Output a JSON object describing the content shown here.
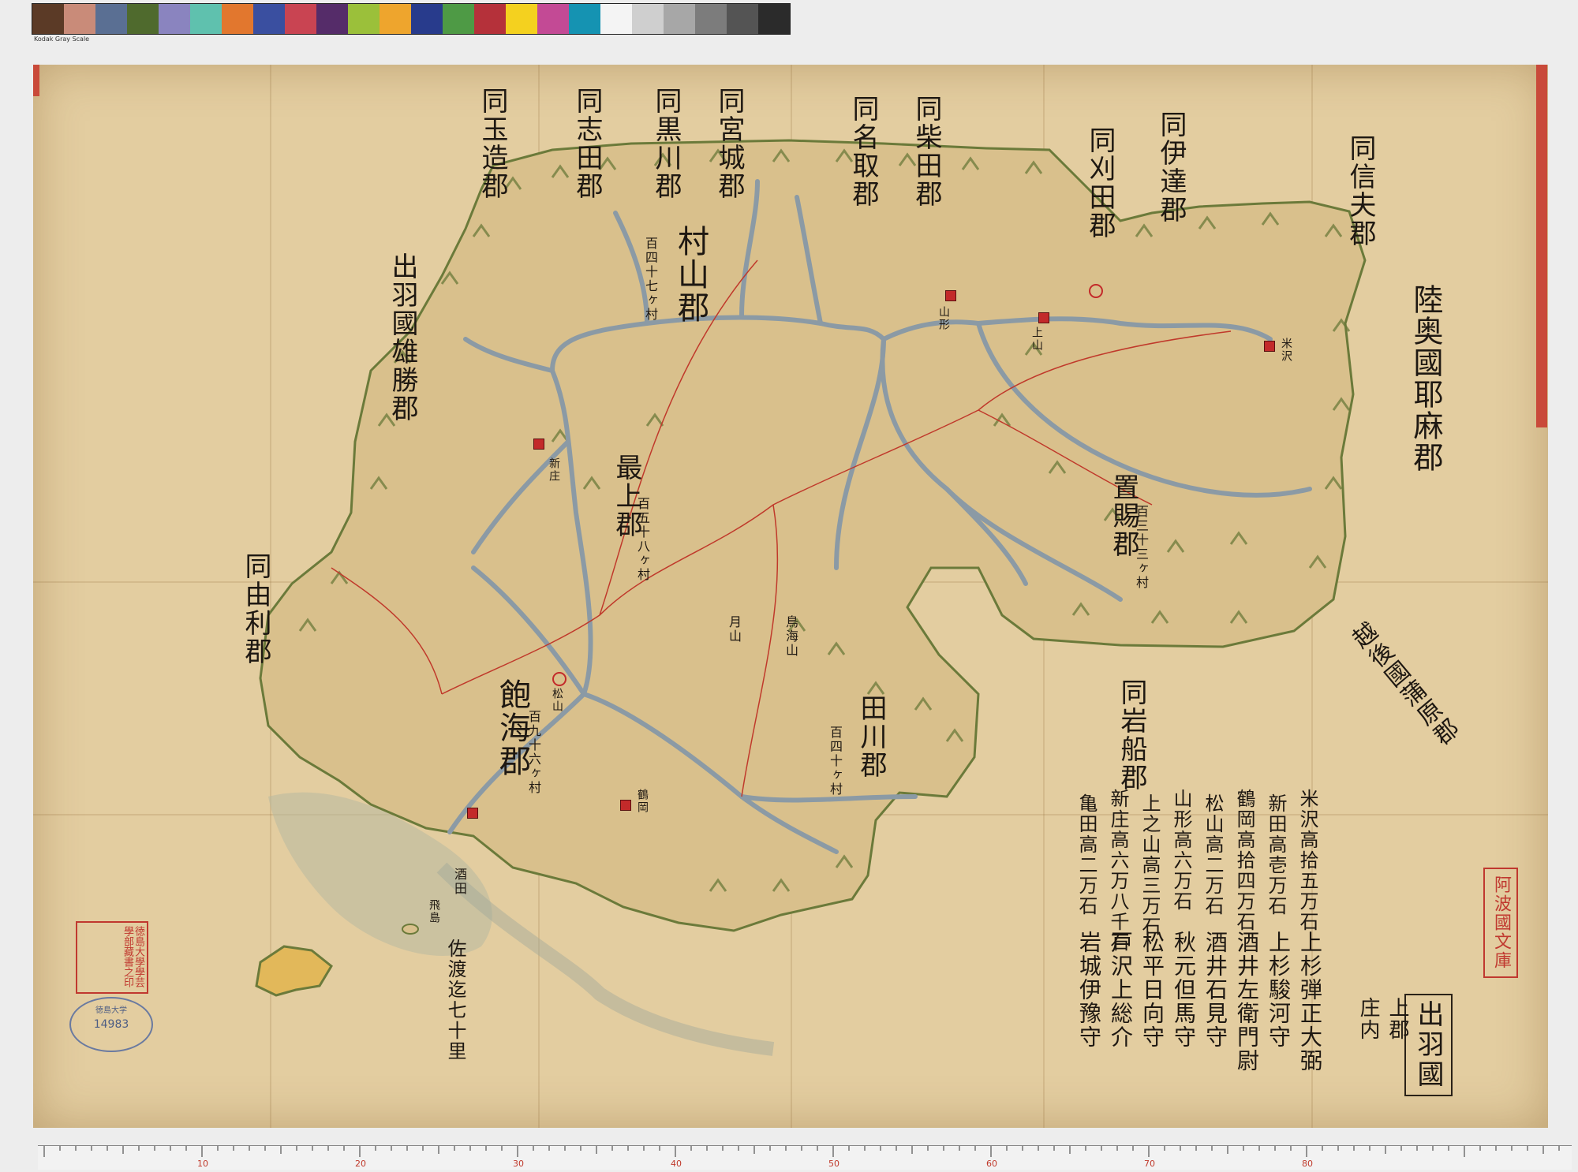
{
  "color_checker": {
    "swatches": [
      "#5b3a26",
      "#c98b79",
      "#5a6f93",
      "#4f6a2d",
      "#8a84bf",
      "#5fc1ae",
      "#e2772e",
      "#3a4fa0",
      "#c94452",
      "#552c69",
      "#9bc03a",
      "#eea52d",
      "#283b8c",
      "#4e9a45",
      "#b5313a",
      "#f4d11f",
      "#c34a95",
      "#1593b2",
      "#f4f4f4",
      "#cfcfcf",
      "#a7a7a7",
      "#7c7c7c",
      "#545454",
      "#2b2b2b"
    ],
    "label": "Kodak Gray Scale"
  },
  "map": {
    "title": "出羽國",
    "title_sub": "上郡\n庄内",
    "colors": {
      "paper": "#e3cda0",
      "river": "#8b9aa5",
      "mountain": "#6b7a3a",
      "road": "#c0392b",
      "sea": "#7f95a3",
      "castle": "#c32a2a"
    },
    "districts": {
      "okitama": {
        "name": "置賜郡",
        "koku": "百三十三ヶ村"
      },
      "murayama": {
        "name": "村山郡",
        "koku": "百四十七ヶ村"
      },
      "mogami": {
        "name": "最上郡",
        "koku": "百五十八ヶ村"
      },
      "akumi": {
        "name": "飽海郡",
        "koku": "百九十六ヶ村"
      },
      "tagawa": {
        "name": "田川郡",
        "koku": "百四十ヶ村"
      }
    },
    "neighbors": {
      "shinobu": "同信夫郡",
      "date": "同伊達郡",
      "katta": "同刈田郡",
      "shibata": "同柴田郡",
      "natori": "同名取郡",
      "miyagi": "同宮城郡",
      "kurokawa": "同黒川郡",
      "shida": "同志田郡",
      "tamatsukuri": "同玉造郡",
      "ogachi": "出羽國雄勝郡",
      "yuri": "同由利郡",
      "yama": "陸奥國耶麻郡",
      "iwafune": "同岩船郡",
      "kanbara": "越後國蒲原郡"
    },
    "places": {
      "shinjo": "新庄",
      "yamagata": "山形",
      "kaminoyama": "上山",
      "yonezawa": "米沢",
      "tsuruoka": "鶴岡",
      "matsuyama": "松山",
      "sakata": "酒田",
      "gassan": "月山",
      "chokai": "鳥海山",
      "tobishima": "飛島",
      "oki": "佐渡迄七十里"
    },
    "lords": [
      {
        "domain": "米沢",
        "koku": "高拾五万石",
        "lord": "上杉弾正大弼"
      },
      {
        "domain": "新田",
        "koku": "高壱万石",
        "lord": "上杉駿河守"
      },
      {
        "domain": "鶴岡",
        "koku": "高拾四万石",
        "lord": "酒井左衛門尉"
      },
      {
        "domain": "松山",
        "koku": "高二万石",
        "lord": "酒井石見守"
      },
      {
        "domain": "山形",
        "koku": "高六万石",
        "lord": "秋元但馬守"
      },
      {
        "domain": "上之山",
        "koku": "高三万石",
        "lord": "松平日向守"
      },
      {
        "domain": "新庄",
        "koku": "高六万八千石",
        "lord": "戸沢上総介"
      },
      {
        "domain": "亀田",
        "koku": "高二万石",
        "lord": "岩城伊豫守"
      }
    ],
    "seals": {
      "awa": "阿波國文庫",
      "tokushima": "徳島大學學芸學部藏書之印",
      "oval_top": "徳島大学",
      "oval_num": "14983"
    }
  },
  "ruler_numbers": [
    "10",
    "20",
    "30",
    "40",
    "50",
    "60",
    "70",
    "80"
  ]
}
